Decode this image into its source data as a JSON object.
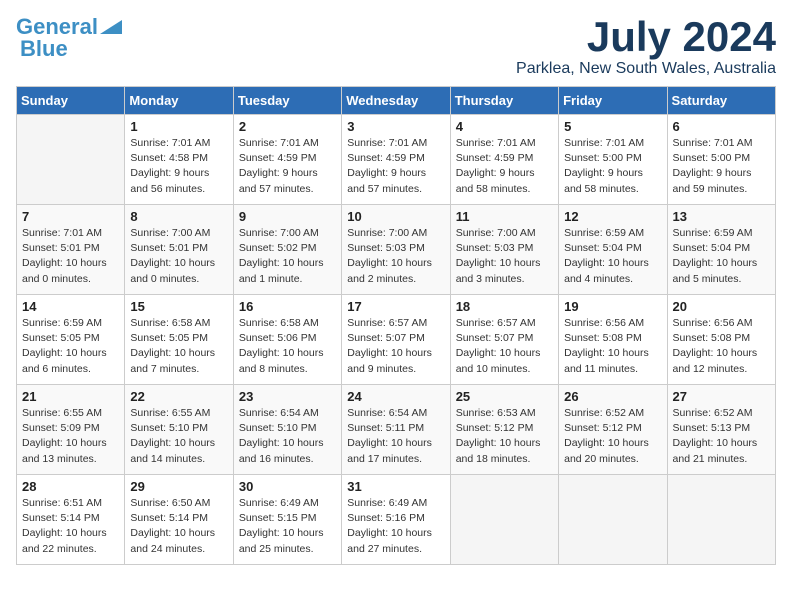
{
  "logo": {
    "line1": "General",
    "line2": "Blue"
  },
  "title": "July 2024",
  "location": "Parklea, New South Wales, Australia",
  "days_of_week": [
    "Sunday",
    "Monday",
    "Tuesday",
    "Wednesday",
    "Thursday",
    "Friday",
    "Saturday"
  ],
  "weeks": [
    [
      {
        "num": "",
        "empty": true
      },
      {
        "num": "1",
        "sunrise": "7:01 AM",
        "sunset": "4:58 PM",
        "daylight": "9 hours and 56 minutes."
      },
      {
        "num": "2",
        "sunrise": "7:01 AM",
        "sunset": "4:59 PM",
        "daylight": "9 hours and 57 minutes."
      },
      {
        "num": "3",
        "sunrise": "7:01 AM",
        "sunset": "4:59 PM",
        "daylight": "9 hours and 57 minutes."
      },
      {
        "num": "4",
        "sunrise": "7:01 AM",
        "sunset": "4:59 PM",
        "daylight": "9 hours and 58 minutes."
      },
      {
        "num": "5",
        "sunrise": "7:01 AM",
        "sunset": "5:00 PM",
        "daylight": "9 hours and 58 minutes."
      },
      {
        "num": "6",
        "sunrise": "7:01 AM",
        "sunset": "5:00 PM",
        "daylight": "9 hours and 59 minutes."
      }
    ],
    [
      {
        "num": "7",
        "sunrise": "7:01 AM",
        "sunset": "5:01 PM",
        "daylight": "10 hours and 0 minutes."
      },
      {
        "num": "8",
        "sunrise": "7:00 AM",
        "sunset": "5:01 PM",
        "daylight": "10 hours and 0 minutes."
      },
      {
        "num": "9",
        "sunrise": "7:00 AM",
        "sunset": "5:02 PM",
        "daylight": "10 hours and 1 minute."
      },
      {
        "num": "10",
        "sunrise": "7:00 AM",
        "sunset": "5:03 PM",
        "daylight": "10 hours and 2 minutes."
      },
      {
        "num": "11",
        "sunrise": "7:00 AM",
        "sunset": "5:03 PM",
        "daylight": "10 hours and 3 minutes."
      },
      {
        "num": "12",
        "sunrise": "6:59 AM",
        "sunset": "5:04 PM",
        "daylight": "10 hours and 4 minutes."
      },
      {
        "num": "13",
        "sunrise": "6:59 AM",
        "sunset": "5:04 PM",
        "daylight": "10 hours and 5 minutes."
      }
    ],
    [
      {
        "num": "14",
        "sunrise": "6:59 AM",
        "sunset": "5:05 PM",
        "daylight": "10 hours and 6 minutes."
      },
      {
        "num": "15",
        "sunrise": "6:58 AM",
        "sunset": "5:05 PM",
        "daylight": "10 hours and 7 minutes."
      },
      {
        "num": "16",
        "sunrise": "6:58 AM",
        "sunset": "5:06 PM",
        "daylight": "10 hours and 8 minutes."
      },
      {
        "num": "17",
        "sunrise": "6:57 AM",
        "sunset": "5:07 PM",
        "daylight": "10 hours and 9 minutes."
      },
      {
        "num": "18",
        "sunrise": "6:57 AM",
        "sunset": "5:07 PM",
        "daylight": "10 hours and 10 minutes."
      },
      {
        "num": "19",
        "sunrise": "6:56 AM",
        "sunset": "5:08 PM",
        "daylight": "10 hours and 11 minutes."
      },
      {
        "num": "20",
        "sunrise": "6:56 AM",
        "sunset": "5:08 PM",
        "daylight": "10 hours and 12 minutes."
      }
    ],
    [
      {
        "num": "21",
        "sunrise": "6:55 AM",
        "sunset": "5:09 PM",
        "daylight": "10 hours and 13 minutes."
      },
      {
        "num": "22",
        "sunrise": "6:55 AM",
        "sunset": "5:10 PM",
        "daylight": "10 hours and 14 minutes."
      },
      {
        "num": "23",
        "sunrise": "6:54 AM",
        "sunset": "5:10 PM",
        "daylight": "10 hours and 16 minutes."
      },
      {
        "num": "24",
        "sunrise": "6:54 AM",
        "sunset": "5:11 PM",
        "daylight": "10 hours and 17 minutes."
      },
      {
        "num": "25",
        "sunrise": "6:53 AM",
        "sunset": "5:12 PM",
        "daylight": "10 hours and 18 minutes."
      },
      {
        "num": "26",
        "sunrise": "6:52 AM",
        "sunset": "5:12 PM",
        "daylight": "10 hours and 20 minutes."
      },
      {
        "num": "27",
        "sunrise": "6:52 AM",
        "sunset": "5:13 PM",
        "daylight": "10 hours and 21 minutes."
      }
    ],
    [
      {
        "num": "28",
        "sunrise": "6:51 AM",
        "sunset": "5:14 PM",
        "daylight": "10 hours and 22 minutes."
      },
      {
        "num": "29",
        "sunrise": "6:50 AM",
        "sunset": "5:14 PM",
        "daylight": "10 hours and 24 minutes."
      },
      {
        "num": "30",
        "sunrise": "6:49 AM",
        "sunset": "5:15 PM",
        "daylight": "10 hours and 25 minutes."
      },
      {
        "num": "31",
        "sunrise": "6:49 AM",
        "sunset": "5:16 PM",
        "daylight": "10 hours and 27 minutes."
      },
      {
        "num": "",
        "empty": true
      },
      {
        "num": "",
        "empty": true
      },
      {
        "num": "",
        "empty": true
      }
    ]
  ],
  "labels": {
    "sunrise": "Sunrise:",
    "sunset": "Sunset:",
    "daylight": "Daylight:"
  }
}
